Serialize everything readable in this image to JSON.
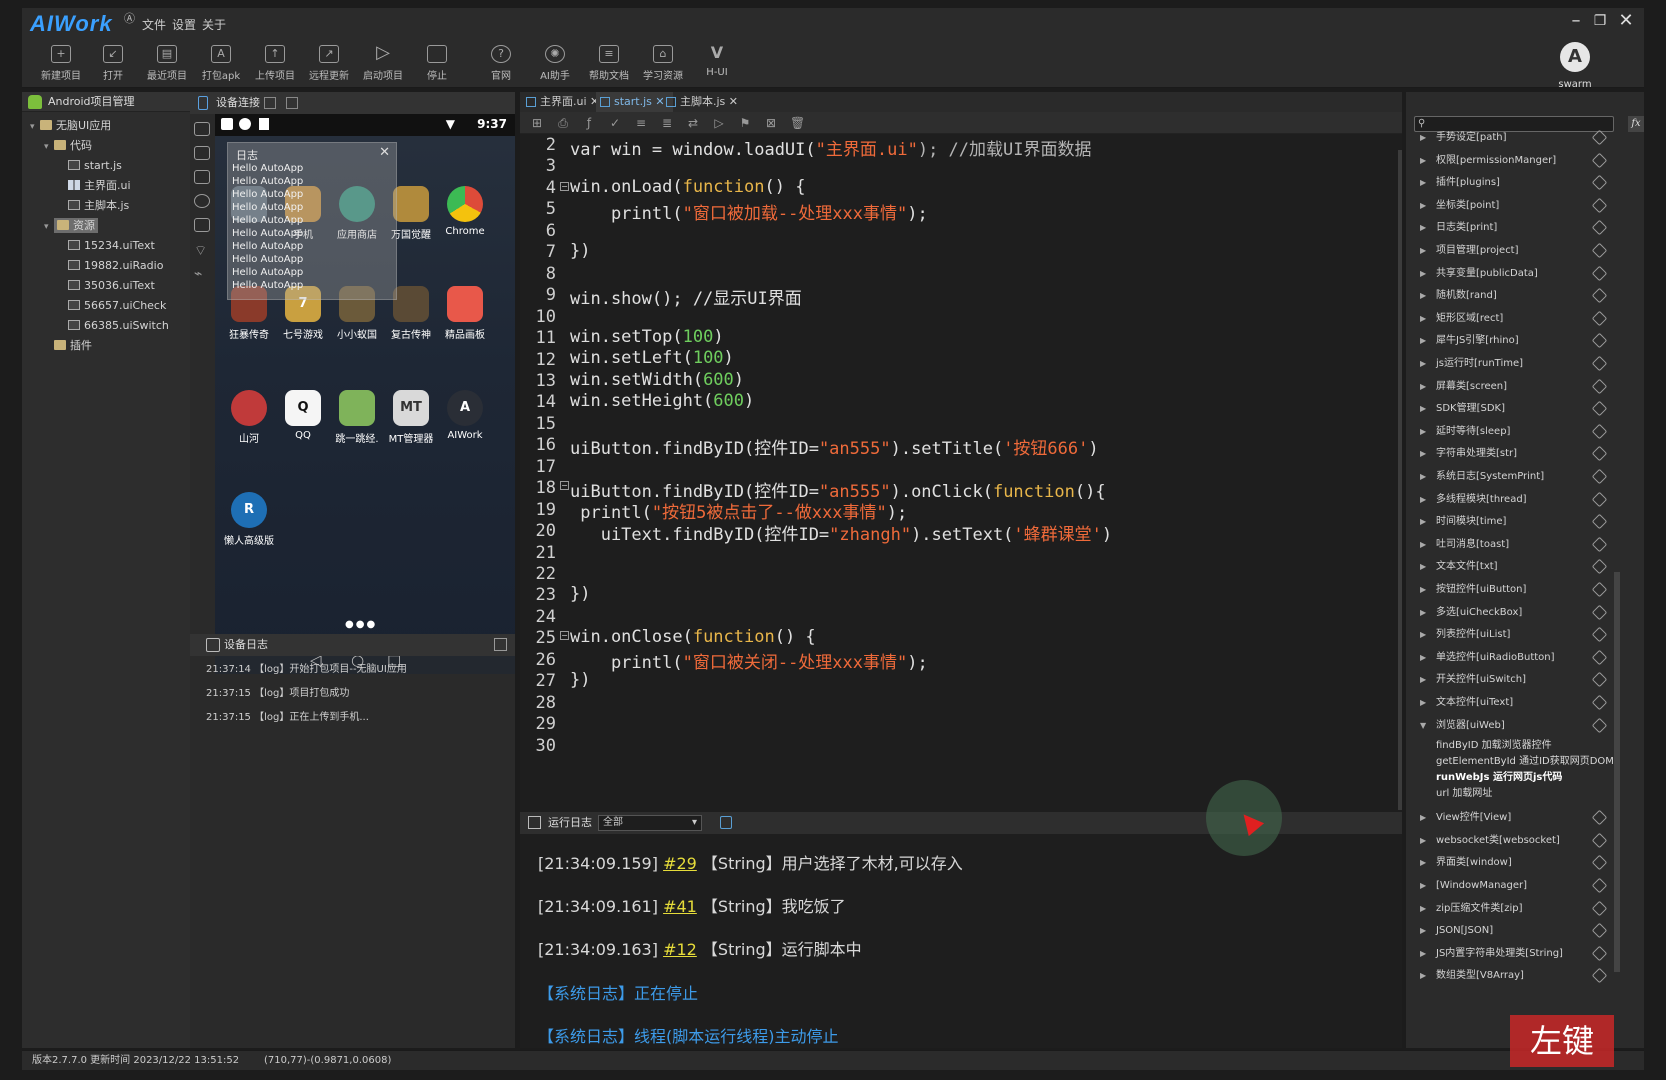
{
  "app": {
    "logo": "AIWork",
    "logo_badge": "Ⓐ",
    "menu": [
      "文件",
      "设置",
      "关于"
    ],
    "window_controls": [
      "–",
      "❐",
      "✕"
    ]
  },
  "toolbar": {
    "buttons": [
      {
        "label": "新建项目",
        "icon": "new-project-icon"
      },
      {
        "label": "打开",
        "icon": "open-icon"
      },
      {
        "label": "最近项目",
        "icon": "recent-icon"
      },
      {
        "label": "打包apk",
        "icon": "apk-icon"
      },
      {
        "label": "上传项目",
        "icon": "upload-icon"
      },
      {
        "label": "远程更新",
        "icon": "remote-update-icon"
      },
      {
        "label": "启动项目",
        "icon": "play-icon"
      },
      {
        "label": "停止",
        "icon": "stop-icon"
      },
      {
        "label": "官网",
        "icon": "help-icon"
      },
      {
        "label": "AI助手",
        "icon": "ai-icon"
      },
      {
        "label": "帮助文档",
        "icon": "doc-icon"
      },
      {
        "label": "学习资源",
        "icon": "learn-icon"
      },
      {
        "label": "H-UI",
        "icon": "hui-icon"
      }
    ],
    "swarm_label": "swarm"
  },
  "project": {
    "header": "Android项目管理",
    "tree": [
      {
        "label": "无脑UI应用",
        "type": "folder",
        "arrow": "▾"
      },
      {
        "label": "代码",
        "type": "folder",
        "arrow": "▾"
      },
      {
        "label": "start.js",
        "type": "file"
      },
      {
        "label": "主界面.ui",
        "type": "grid"
      },
      {
        "label": "主脚本.js",
        "type": "file"
      },
      {
        "label": "资源",
        "type": "folder",
        "arrow": "▾"
      },
      {
        "label": "15234.uiText",
        "type": "file"
      },
      {
        "label": "19882.uiRadio",
        "type": "file"
      },
      {
        "label": "35036.uiText",
        "type": "file"
      },
      {
        "label": "56657.uiCheck",
        "type": "file"
      },
      {
        "label": "66385.uiSwitch",
        "type": "file"
      },
      {
        "label": "插件",
        "type": "folder"
      }
    ]
  },
  "device": {
    "header": "设备连接",
    "status_time": "9:37",
    "log_popup": {
      "title": "日志",
      "close": "✕",
      "lines": [
        "Hello AutoApp",
        "Hello AutoApp",
        "Hello AutoApp",
        "Hello AutoApp",
        "Hello AutoApp",
        "Hello AutoApp",
        "Hello AutoApp",
        "Hello AutoApp",
        "Hello AutoApp",
        "Hello AutoApp"
      ]
    },
    "apps_row1": [
      {
        "label": "",
        "color": "#5a6b7a"
      },
      {
        "label": "手机",
        "color": "#c08a3a"
      },
      {
        "label": "应用商店",
        "color": "#2f8f7a"
      },
      {
        "label": "万国觉醒",
        "color": "#b08a3c"
      },
      {
        "label": "Chrome",
        "color": "#dd4b39"
      }
    ],
    "apps_row2": [
      {
        "label": "狂暴传奇",
        "color": "#8a3a2a"
      },
      {
        "label": "七号游戏",
        "color": "#c9a040"
      },
      {
        "label": "小小蚁国",
        "color": "#6b5a3a"
      },
      {
        "label": "复古传神",
        "color": "#5a4a35"
      },
      {
        "label": "精品画板",
        "color": "#e8584a"
      }
    ],
    "apps_row3": [
      {
        "label": "山河",
        "color": "#c03a3a"
      },
      {
        "label": "QQ",
        "color": "#f5f5f5"
      },
      {
        "label": "跳一跳经.",
        "color": "#7fb35a"
      },
      {
        "label": "MT管理器",
        "color": "#d9d9d9"
      },
      {
        "label": "AIWork",
        "color": "#2a2e36"
      }
    ],
    "apps_row4": [
      {
        "label": "懒人高级版",
        "color": "#1e6fb5"
      }
    ],
    "page_dots": "●●●",
    "nav": [
      "◁",
      "○",
      "□"
    ]
  },
  "device_log": {
    "header": "设备日志",
    "lines": [
      "21:37:14 【log】开始打包项目--无脑UI应用",
      "21:37:15 【log】项目打包成功",
      "21:37:15 【log】正在上传到手机..."
    ]
  },
  "editor": {
    "tabs": [
      "主界面.ui",
      "start.js",
      "主脚本.js"
    ],
    "active_tab": 1,
    "toolbar_icons": [
      "⊞",
      "⎙",
      "ƒ",
      "✓",
      "≡",
      "≣",
      "⇄",
      "▷",
      "⚑",
      "⊠",
      "🗑"
    ],
    "line_numbers": [
      "2",
      "3",
      "4",
      "5",
      "6",
      "7",
      "8",
      "9",
      "10",
      "11",
      "12",
      "13",
      "14",
      "15",
      "16",
      "17",
      "18",
      "19",
      "20",
      "21",
      "22",
      "23",
      "24",
      "25",
      "26",
      "27",
      "28",
      "29",
      "30"
    ],
    "code": {
      "l2_a": "var win = window.loadUI(",
      "l2_b": "\"主界面.ui\"",
      "l2_c": "); //加载UI界面数据",
      "l4_a": "win.onLoad(",
      "l4_b": "function",
      "l4_c": "() {",
      "l5_a": "    printl(",
      "l5_b": "\"窗口被加载--处理xxx事情\"",
      "l5_c": ");",
      "l7": "})",
      "l9": "win.show(); //显示UI界面",
      "l11_a": "win.setTop(",
      "l11_b": "100",
      "l11_c": ")",
      "l12_a": "win.setLeft(",
      "l12_b": "100",
      "l12_c": ")",
      "l13_a": "win.setWidth(",
      "l13_b": "600",
      "l13_c": ")",
      "l14_a": "win.setHeight(",
      "l14_b": "600",
      "l14_c": ")",
      "l16_a": "uiButton.findByID(控件ID=",
      "l16_b": "\"an555\"",
      "l16_c": ").setTitle(",
      "l16_d": "'按钮666'",
      "l16_e": ")",
      "l18_a": "uiButton.findByID(控件ID=",
      "l18_b": "\"an555\"",
      "l18_c": ").onClick(",
      "l18_d": "function",
      "l18_e": "(){",
      "l19_a": " printl(",
      "l19_b": "\"按钮5被点击了--做xxx事情\"",
      "l19_c": ");",
      "l20_a": "   uiText.findByID(控件ID=",
      "l20_b": "\"zhangh\"",
      "l20_c": ").setText(",
      "l20_d": "'蜂群课堂'",
      "l20_e": ")",
      "l23": "})",
      "l25_a": "win.onClose(",
      "l25_b": "function",
      "l25_c": "() {",
      "l26_a": "    printl(",
      "l26_b": "\"窗口被关闭--处理xxx事情\"",
      "l26_c": ");",
      "l27": "})"
    }
  },
  "runlog": {
    "header": "运行日志",
    "filter_value": "全部",
    "entries": [
      {
        "time": "[21:34:09.159]",
        "id": "#29",
        "text": "【String】用户选择了木材,可以存入"
      },
      {
        "time": "[21:34:09.161]",
        "id": "#41",
        "text": "【String】我吃饭了"
      },
      {
        "time": "[21:34:09.163]",
        "id": "#12",
        "text": "【String】运行脚本中"
      }
    ],
    "system": [
      "【系统日志】正在停止",
      "【系统日志】线程(脚本运行线程)主动停止"
    ]
  },
  "api": {
    "search_placeholder": "",
    "fx": "fx",
    "items_top": [
      "手势设定[path]",
      "权限[permissionManger]",
      "插件[plugins]",
      "坐标类[point]",
      "日志类[print]",
      "项目管理[project]",
      "共享变量[publicData]",
      "随机数[rand]",
      "矩形区域[rect]",
      "犀牛JS引擎[rhino]",
      "js运行时[runTime]",
      "屏幕类[screen]",
      "SDK管理[SDK]",
      "延时等待[sleep]",
      "字符串处理类[str]",
      "系统日志[SystemPrint]",
      "多线程模块[thread]",
      "时间模块[time]",
      "吐司消息[toast]",
      "文本文件[txt]",
      "按钮控件[uiButton]",
      "多选[uiCheckBox]",
      "列表控件[uiList]",
      "单选控件[uiRadioButton]",
      "开关控件[uiSwitch]",
      "文本控件[uiText]"
    ],
    "expanded": "浏览器[uiWeb]",
    "sub_items": [
      "findByID 加载浏览器控件",
      "getElementById 通过ID获取网页DOM",
      "runWebJs 运行网页js代码",
      "url 加载网址"
    ],
    "items_bottom": [
      "View控件[View]",
      "websocket类[websocket]",
      "界面类[window]",
      "[WindowManager]",
      "zip压缩文件类[zip]",
      "JSON[JSON]",
      "JS内置字符串处理类[String]",
      "数组类型[V8Array]"
    ]
  },
  "status": {
    "version": "版本2.7.7.0 更新时间 2023/12/22 13:51:52",
    "coords": "(710,77)-(0.9871,0.0608)"
  },
  "overlay": {
    "left_click": "左键"
  }
}
